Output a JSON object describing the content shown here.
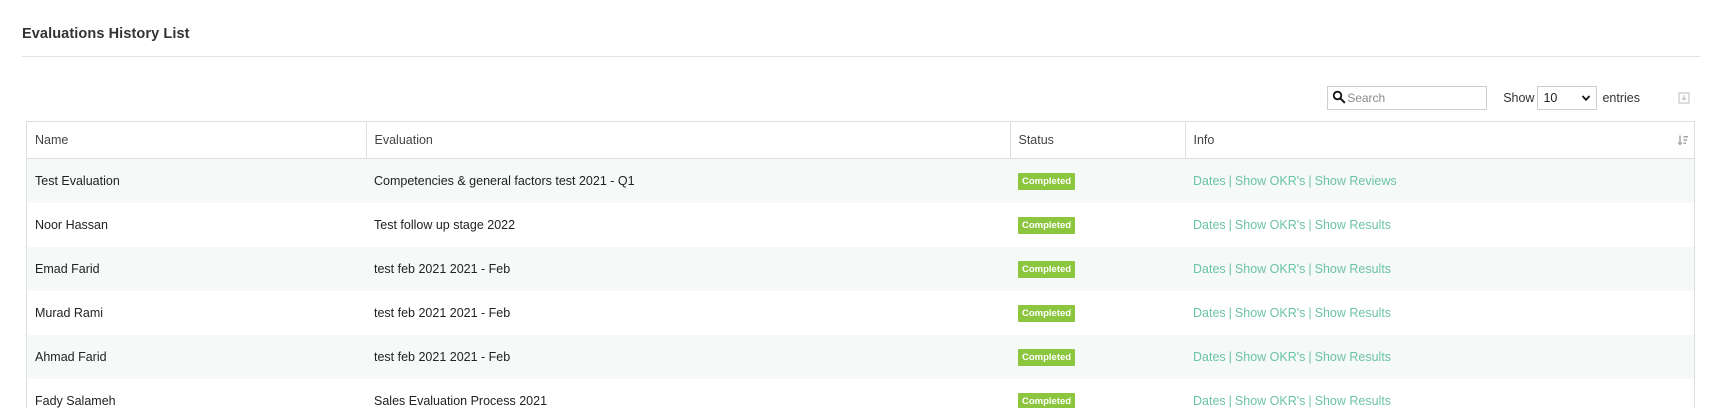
{
  "page": {
    "title": "Evaluations History List"
  },
  "toolbar": {
    "search_placeholder": "Search",
    "show_label": "Show",
    "entries_value": "10",
    "entries_label": "entries"
  },
  "table": {
    "columns": [
      "Name",
      "Evaluation",
      "Status",
      "Info"
    ],
    "rows": [
      {
        "name": "Test Evaluation",
        "evaluation": "Competencies & general factors test 2021 - Q1",
        "status": "Completed",
        "links": [
          "Dates",
          "Show OKR's",
          "Show Reviews"
        ]
      },
      {
        "name": "Noor Hassan",
        "evaluation": "Test follow up stage 2022",
        "status": "Completed",
        "links": [
          "Dates",
          "Show OKR's",
          "Show Results"
        ]
      },
      {
        "name": "Emad Farid",
        "evaluation": "test feb 2021 2021 - Feb",
        "status": "Completed",
        "links": [
          "Dates",
          "Show OKR's",
          "Show Results"
        ]
      },
      {
        "name": "Murad Rami",
        "evaluation": "test feb 2021 2021 - Feb",
        "status": "Completed",
        "links": [
          "Dates",
          "Show OKR's",
          "Show Results"
        ]
      },
      {
        "name": "Ahmad Farid",
        "evaluation": "test feb 2021 2021 - Feb",
        "status": "Completed",
        "links": [
          "Dates",
          "Show OKR's",
          "Show Results"
        ]
      },
      {
        "name": "Fady Salameh",
        "evaluation": "Sales Evaluation Process 2021",
        "status": "Completed",
        "links": [
          "Dates",
          "Show OKR's",
          "Show Results"
        ]
      }
    ]
  },
  "colors": {
    "status_completed": "#8cc63f",
    "link": "#6cc3a7",
    "row_stripe": "#f5f9f8"
  },
  "icons": {
    "search": "search-icon",
    "select": "chevron-down-icon",
    "export": "export-icon",
    "sort": "sort-icon"
  }
}
